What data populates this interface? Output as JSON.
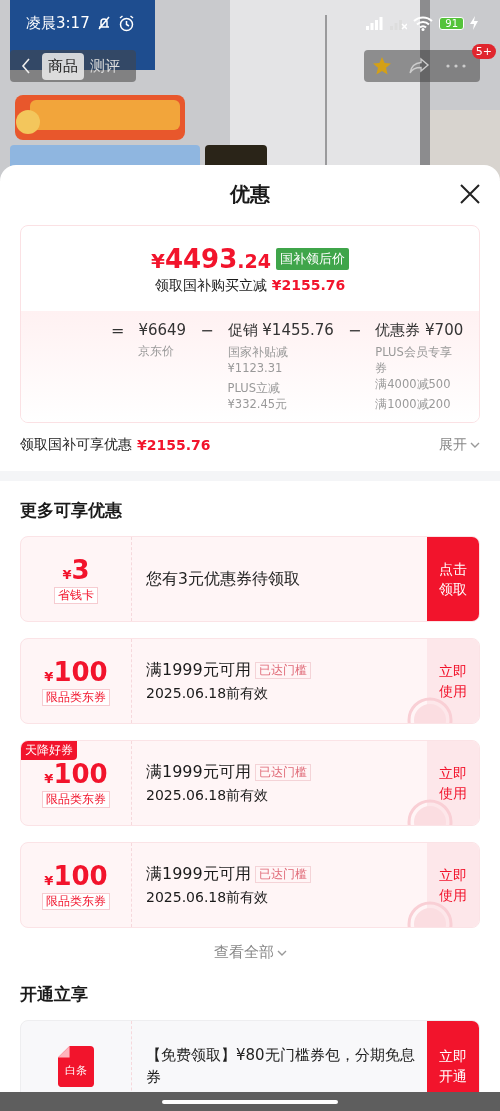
{
  "status_bar": {
    "time": "凌晨3:17",
    "battery": "91"
  },
  "nav": {
    "tabs": [
      {
        "label": "商品",
        "selected": true
      },
      {
        "label": "测评",
        "selected": false
      }
    ],
    "badge": "5+"
  },
  "sheet": {
    "title": "优惠"
  },
  "price_card": {
    "symbol": "¥",
    "integer": "4493",
    "decimal": ".24",
    "price_tag": "国补领后价",
    "saving_label": "领取国补购买立减",
    "saving_amount": "¥2155.76",
    "formula": [
      {
        "op": "=",
        "amount": "¥6649",
        "notes": [
          {
            "lines": [
              "京东价"
            ]
          }
        ]
      },
      {
        "op": "−",
        "amount": "促销 ¥1455.76",
        "notes": [
          {
            "lines": [
              "国家补贴减",
              "¥1123.31"
            ]
          },
          {
            "lines": [
              "PLUS立减",
              "¥332.45元"
            ]
          }
        ]
      },
      {
        "op": "−",
        "amount": "优惠券 ¥700",
        "notes": [
          {
            "lines": [
              "PLUS会员专享",
              "券",
              "满4000减500"
            ]
          },
          {
            "lines": [
              "满1000减200"
            ]
          }
        ]
      }
    ]
  },
  "summary": {
    "label": "领取国补可享优惠",
    "amount": "¥2155.76",
    "expand": "展开"
  },
  "more_offers": {
    "title": "更多可享优惠",
    "items": [
      {
        "kind": "card",
        "symbol": "¥",
        "amount": "3",
        "tag": "省钱卡",
        "text": "您有3元优惠券待领取",
        "action": "点击领取"
      },
      {
        "kind": "coupon",
        "symbol": "¥",
        "amount": "100",
        "tag": "限品类东券",
        "title": "满1999元可用",
        "status": "已达门槛",
        "validity": "2025.06.18前有效",
        "action": "立即使用"
      },
      {
        "kind": "coupon",
        "label": "天降好券",
        "symbol": "¥",
        "amount": "100",
        "tag": "限品类东券",
        "title": "满1999元可用",
        "status": "已达门槛",
        "validity": "2025.06.18前有效",
        "action": "立即使用"
      },
      {
        "kind": "coupon",
        "symbol": "¥",
        "amount": "100",
        "tag": "限品类东券",
        "title": "满1999元可用",
        "status": "已达门槛",
        "validity": "2025.06.18前有效",
        "action": "立即使用"
      }
    ]
  },
  "view_all": "查看全部",
  "open_section": {
    "title": "开通立享",
    "items": [
      {
        "kind": "service",
        "icon_label": "白条",
        "text": "【免费领取】¥80无门槛券包，分期免息券",
        "action": "立即开通"
      }
    ]
  }
}
